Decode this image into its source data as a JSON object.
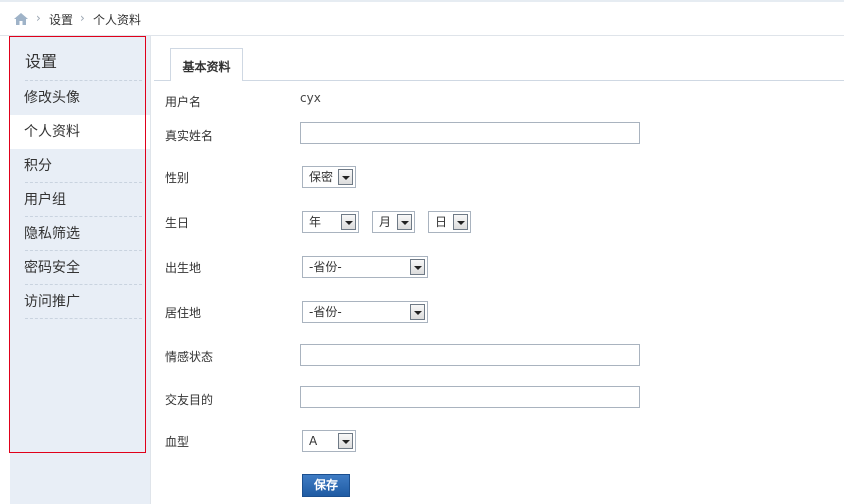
{
  "breadcrumb": {
    "home_icon": "home-icon",
    "items": [
      "设置",
      "个人资料"
    ]
  },
  "sidebar": {
    "title": "设置",
    "items": [
      {
        "label": "修改头像",
        "active": false
      },
      {
        "label": "个人资料",
        "active": true
      },
      {
        "label": "积分",
        "active": false
      },
      {
        "label": "用户组",
        "active": false
      },
      {
        "label": "隐私筛选",
        "active": false
      },
      {
        "label": "密码安全",
        "active": false
      },
      {
        "label": "访问推广",
        "active": false
      }
    ]
  },
  "tabs": [
    {
      "label": "基本资料",
      "active": true
    }
  ],
  "form": {
    "username": {
      "label": "用户名",
      "value": "cyx"
    },
    "realname": {
      "label": "真实姓名",
      "value": ""
    },
    "gender": {
      "label": "性别",
      "selected": "保密"
    },
    "birthday": {
      "label": "生日",
      "year": "年",
      "month": "月",
      "day": "日"
    },
    "birthplace": {
      "label": "出生地",
      "selected": "-省份-"
    },
    "residence": {
      "label": "居住地",
      "selected": "-省份-"
    },
    "relationship": {
      "label": "情感状态",
      "value": ""
    },
    "purpose": {
      "label": "交友目的",
      "value": ""
    },
    "bloodtype": {
      "label": "血型",
      "selected": "A"
    },
    "save_label": "保存"
  },
  "colors": {
    "accent": "#2a64b0",
    "sidebar_bg": "#e8eef6",
    "highlight_border": "#e0001a"
  }
}
